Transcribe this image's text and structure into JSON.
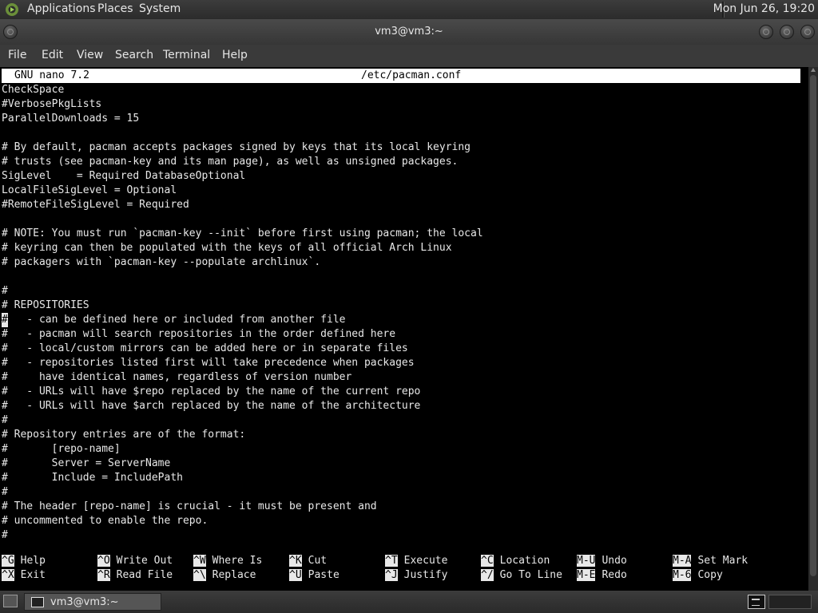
{
  "top_panel": {
    "menus": [
      "Applications",
      "Places",
      "System"
    ],
    "clock": "Mon Jun 26, 19:20"
  },
  "window": {
    "title": "vm3@vm3:~",
    "menu": [
      "File",
      "Edit",
      "View",
      "Search",
      "Terminal",
      "Help"
    ]
  },
  "nano": {
    "version": "GNU nano 7.2",
    "filename": "/etc/pacman.conf",
    "lines": [
      "CheckSpace",
      "#VerbosePkgLists",
      "ParallelDownloads = 15",
      "",
      "# By default, pacman accepts packages signed by keys that its local keyring",
      "# trusts (see pacman-key and its man page), as well as unsigned packages.",
      "SigLevel    = Required DatabaseOptional",
      "LocalFileSigLevel = Optional",
      "#RemoteFileSigLevel = Required",
      "",
      "# NOTE: You must run `pacman-key --init` before first using pacman; the local",
      "# keyring can then be populated with the keys of all official Arch Linux",
      "# packagers with `pacman-key --populate archlinux`.",
      "",
      "#",
      "# REPOSITORIES",
      "#   - can be defined here or included from another file",
      "#   - pacman will search repositories in the order defined here",
      "#   - local/custom mirrors can be added here or in separate files",
      "#   - repositories listed first will take precedence when packages",
      "#     have identical names, regardless of version number",
      "#   - URLs will have $repo replaced by the name of the current repo",
      "#   - URLs will have $arch replaced by the name of the architecture",
      "#",
      "# Repository entries are of the format:",
      "#       [repo-name]",
      "#       Server = ServerName",
      "#       Include = IncludePath",
      "#",
      "# The header [repo-name] is crucial - it must be present and",
      "# uncommented to enable the repo.",
      "#"
    ],
    "shortcuts_row1": [
      {
        "key": "^G",
        "label": "Help"
      },
      {
        "key": "^O",
        "label": "Write Out"
      },
      {
        "key": "^W",
        "label": "Where Is"
      },
      {
        "key": "^K",
        "label": "Cut"
      },
      {
        "key": "^T",
        "label": "Execute"
      },
      {
        "key": "^C",
        "label": "Location"
      },
      {
        "key": "M-U",
        "label": "Undo"
      },
      {
        "key": "M-A",
        "label": "Set Mark"
      }
    ],
    "shortcuts_row2": [
      {
        "key": "^X",
        "label": "Exit"
      },
      {
        "key": "^R",
        "label": "Read File"
      },
      {
        "key": "^\\",
        "label": "Replace"
      },
      {
        "key": "^U",
        "label": "Paste"
      },
      {
        "key": "^J",
        "label": "Justify"
      },
      {
        "key": "^/",
        "label": "Go To Line"
      },
      {
        "key": "M-E",
        "label": "Redo"
      },
      {
        "key": "M-6",
        "label": "Copy"
      }
    ]
  },
  "taskbar": {
    "task_label": "vm3@vm3:~"
  }
}
